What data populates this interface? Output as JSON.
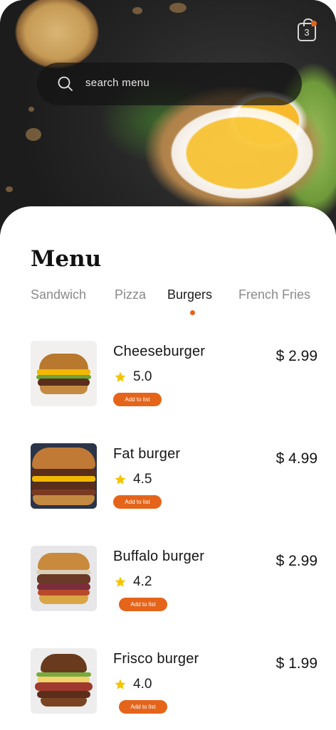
{
  "header": {
    "cart_count": "3",
    "search_placeholder": "search menu"
  },
  "menu": {
    "title": "Menu",
    "tabs": [
      {
        "label": "Sandwich",
        "active": false
      },
      {
        "label": "Pizza",
        "active": false
      },
      {
        "label": "Burgers",
        "active": true
      },
      {
        "label": "French Fries",
        "active": false
      }
    ]
  },
  "items": [
    {
      "name": "Cheeseburger",
      "rating": "5.0",
      "price": "$ 2.99",
      "button": "Add to list"
    },
    {
      "name": "Fat burger",
      "rating": "4.5",
      "price": "$ 4.99",
      "button": "Add to list"
    },
    {
      "name": "Buffalo burger",
      "rating": "4.2",
      "price": "$ 2.99",
      "button": "Add to list"
    },
    {
      "name": "Frisco burger",
      "rating": "4.0",
      "price": "$ 1.99",
      "button": "Add to list"
    }
  ],
  "colors": {
    "accent": "#e4641a",
    "star": "#f5c400",
    "text": "#151515",
    "inactive_tab": "#8a8a8a"
  },
  "icons": [
    "search-icon",
    "cart-icon",
    "star-icon"
  ]
}
